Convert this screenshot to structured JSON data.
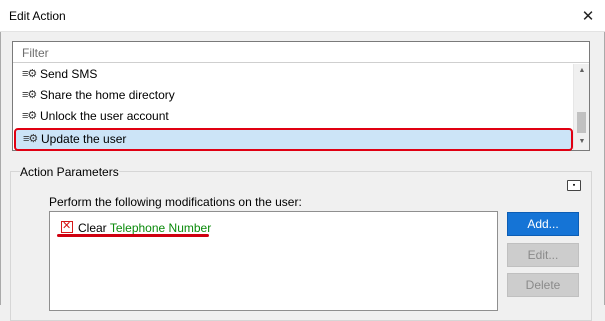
{
  "window": {
    "title": "Edit Action",
    "close_glyph": "✕"
  },
  "filter": {
    "placeholder": "Filter"
  },
  "actions": [
    {
      "label": "Send SMS",
      "icon": "gear-icon",
      "selected": false
    },
    {
      "label": "Share the home directory",
      "icon": "gear-icon",
      "selected": false
    },
    {
      "label": "Unlock the user account",
      "icon": "gear-icon",
      "selected": false
    },
    {
      "label": "Update the user",
      "icon": "gear-icon",
      "selected": true
    }
  ],
  "parameters": {
    "group_title": "Action Parameters",
    "instruction": "Perform the following modifications on the user:",
    "modification": {
      "verb": "Clear",
      "attribute": "Telephone Number",
      "icon": "clear-icon"
    }
  },
  "buttons": {
    "add": "Add...",
    "edit": "Edit...",
    "delete": "Delete"
  },
  "colors": {
    "selection": "#cce4f7",
    "highlight": "#e00012",
    "attribute": "#0a8a0a",
    "primary": "#1574d6"
  }
}
